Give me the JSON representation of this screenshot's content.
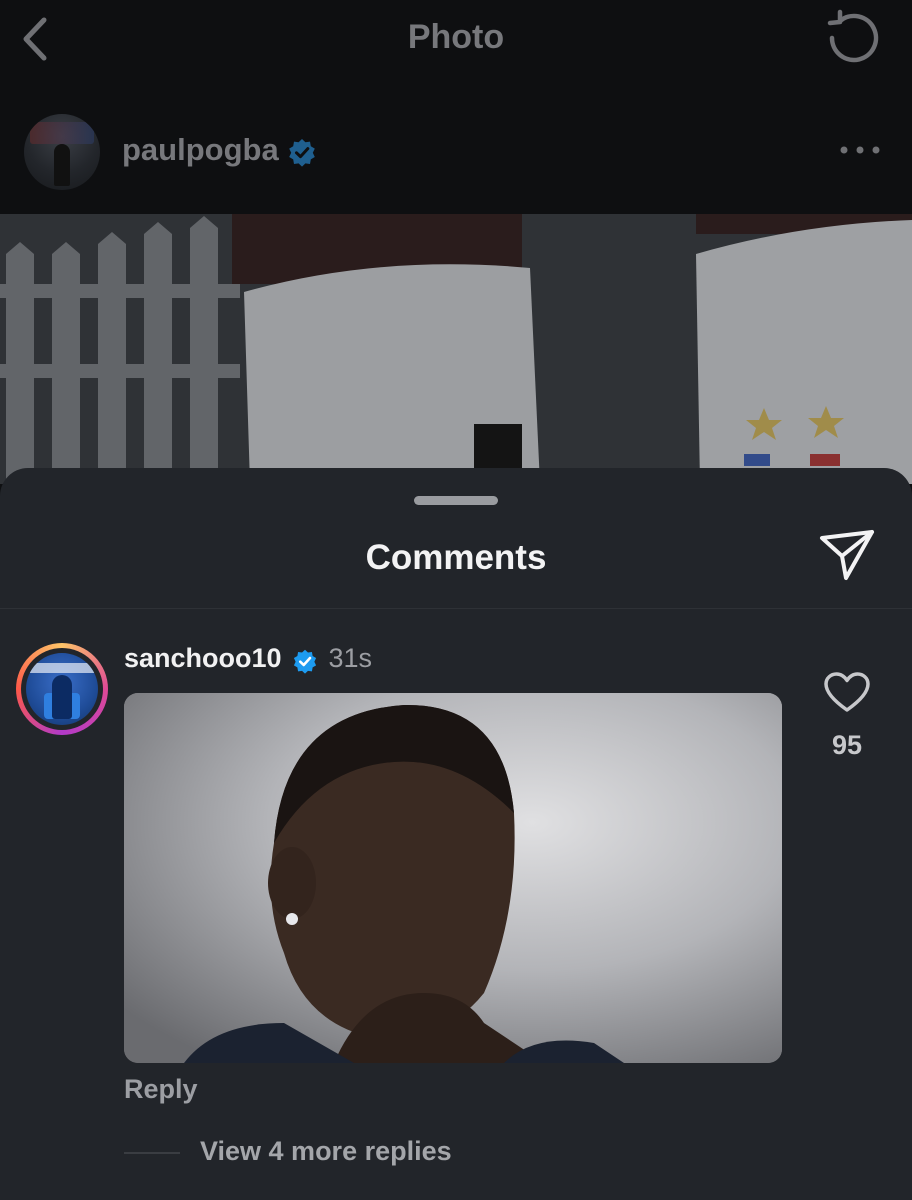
{
  "nav": {
    "title": "Photo",
    "back_icon": "chevron-left-icon",
    "refresh_icon": "refresh-icon"
  },
  "post": {
    "username": "paulpogba",
    "verified": true,
    "more_icon": "more-horizontal-icon"
  },
  "comments": {
    "title": "Comments",
    "share_icon": "send-icon",
    "items": [
      {
        "username": "sanchooo10",
        "verified": true,
        "time": "31s",
        "media": "gif",
        "likes": "95",
        "reply_label": "Reply",
        "view_replies_label": "View 4 more replies"
      }
    ]
  },
  "colors": {
    "background": "#0f1012",
    "sheet": "#22252a",
    "verified_blue": "#1d9bf0",
    "primary_text": "#f3f3f4",
    "secondary_text": "#9c9ea3"
  }
}
